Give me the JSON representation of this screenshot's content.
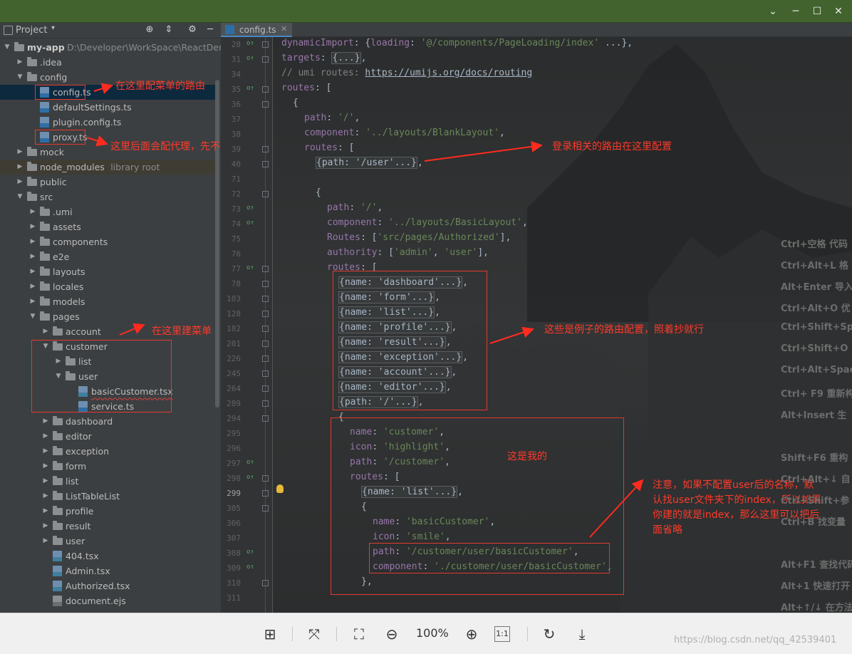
{
  "window": {
    "minimize": "─",
    "maximize": "☐",
    "close": "✕",
    "chevron": "⌄"
  },
  "project_panel": {
    "title": "Project",
    "icons": [
      "target-icon",
      "collapse-icon",
      "gear-icon",
      "hide-icon"
    ]
  },
  "tree": [
    {
      "label": "my-app",
      "hint": "D:\\Developer\\WorkSpace\\ReactDemo",
      "depth": 0,
      "kind": "folder",
      "open": true,
      "bold": true
    },
    {
      "label": ".idea",
      "depth": 1,
      "kind": "folder",
      "open": false
    },
    {
      "label": "config",
      "depth": 1,
      "kind": "folder",
      "open": true
    },
    {
      "label": "config.ts",
      "depth": 2,
      "kind": "ts",
      "selected": true,
      "boxed": true
    },
    {
      "label": "defaultSettings.ts",
      "depth": 2,
      "kind": "ts"
    },
    {
      "label": "plugin.config.ts",
      "depth": 2,
      "kind": "ts"
    },
    {
      "label": "proxy.ts",
      "depth": 2,
      "kind": "ts",
      "boxed": true
    },
    {
      "label": "mock",
      "depth": 1,
      "kind": "folder",
      "open": false
    },
    {
      "label": "node_modules",
      "hint": "library root",
      "depth": 1,
      "kind": "folder",
      "open": false,
      "ignored": true
    },
    {
      "label": "public",
      "depth": 1,
      "kind": "folder",
      "open": false
    },
    {
      "label": "src",
      "depth": 1,
      "kind": "folder",
      "open": true
    },
    {
      "label": ".umi",
      "depth": 2,
      "kind": "folder",
      "open": false
    },
    {
      "label": "assets",
      "depth": 2,
      "kind": "folder",
      "open": false
    },
    {
      "label": "components",
      "depth": 2,
      "kind": "folder",
      "open": false
    },
    {
      "label": "e2e",
      "depth": 2,
      "kind": "folder",
      "open": false
    },
    {
      "label": "layouts",
      "depth": 2,
      "kind": "folder",
      "open": false
    },
    {
      "label": "locales",
      "depth": 2,
      "kind": "folder",
      "open": false
    },
    {
      "label": "models",
      "depth": 2,
      "kind": "folder",
      "open": false
    },
    {
      "label": "pages",
      "depth": 2,
      "kind": "folder",
      "open": true
    },
    {
      "label": "account",
      "depth": 3,
      "kind": "folder",
      "open": false
    },
    {
      "label": "customer",
      "depth": 3,
      "kind": "folder",
      "open": true
    },
    {
      "label": "list",
      "depth": 4,
      "kind": "folder",
      "open": false
    },
    {
      "label": "user",
      "depth": 4,
      "kind": "folder",
      "open": true
    },
    {
      "label": "basicCustomer.tsx",
      "depth": 5,
      "kind": "tsx",
      "squig": true
    },
    {
      "label": "service.ts",
      "depth": 5,
      "kind": "ts"
    },
    {
      "label": "dashboard",
      "depth": 3,
      "kind": "folder",
      "open": false
    },
    {
      "label": "editor",
      "depth": 3,
      "kind": "folder",
      "open": false
    },
    {
      "label": "exception",
      "depth": 3,
      "kind": "folder",
      "open": false
    },
    {
      "label": "form",
      "depth": 3,
      "kind": "folder",
      "open": false
    },
    {
      "label": "list",
      "depth": 3,
      "kind": "folder",
      "open": false
    },
    {
      "label": "ListTableList",
      "depth": 3,
      "kind": "folder",
      "open": false
    },
    {
      "label": "profile",
      "depth": 3,
      "kind": "folder",
      "open": false
    },
    {
      "label": "result",
      "depth": 3,
      "kind": "folder",
      "open": false
    },
    {
      "label": "user",
      "depth": 3,
      "kind": "folder",
      "open": false
    },
    {
      "label": "404.tsx",
      "depth": 3,
      "kind": "tsx"
    },
    {
      "label": "Admin.tsx",
      "depth": 3,
      "kind": "tsx"
    },
    {
      "label": "Authorized.tsx",
      "depth": 3,
      "kind": "tsx"
    },
    {
      "label": "document.ejs",
      "depth": 3,
      "kind": "ejs"
    }
  ],
  "annotations": {
    "config": "在这里配菜单的路由",
    "proxy": "这里后面会配代理，先不管",
    "menu": "在这里建菜单",
    "login": "登录相关的路由在这里配置",
    "examples": "这些是例子的路由配置，照着抄就行",
    "mine": "这是我的",
    "note": [
      "注意，如果不配置user后的名称，默",
      "认找user文件夹下的index，所以如果",
      "你建的就是index，那么这里可以把后",
      "面省略"
    ]
  },
  "editor": {
    "tab": "config.ts",
    "current_line": "299",
    "lines": [
      {
        "n": "28",
        "mark": "o↑",
        "indent": 0,
        "html": "<span class='k'>dynamicImport</span>: {<span class='k'>loading</span>: <span class='s'>'@/components/PageLoading/index'</span> ...},"
      },
      {
        "n": "31",
        "mark": "o↑",
        "indent": 0,
        "html": "<span class='k'>targets</span>: <span class='fd'>{...}</span>,"
      },
      {
        "n": "34",
        "mark": "",
        "indent": 0,
        "html": "<span class='c'>// umi routes: </span><span class='u'>https://umijs.org/docs/routing</span>"
      },
      {
        "n": "35",
        "mark": "o↑",
        "indent": 0,
        "html": "<span class='k'>routes</span>: ["
      },
      {
        "n": "36",
        "mark": "",
        "indent": 1,
        "html": "{"
      },
      {
        "n": "37",
        "mark": "",
        "indent": 2,
        "html": "<span class='k'>path</span>: <span class='s'>'/'</span>,"
      },
      {
        "n": "38",
        "mark": "",
        "indent": 2,
        "html": "<span class='k'>component</span>: <span class='s'>'../layouts/BlankLayout'</span>,"
      },
      {
        "n": "39",
        "mark": "",
        "indent": 2,
        "html": "<span class='k'>routes</span>: ["
      },
      {
        "n": "40",
        "mark": "",
        "indent": 3,
        "html": "<span class='fd'>{path: '/user'...}</span>,"
      },
      {
        "n": "71",
        "mark": "",
        "indent": 0,
        "html": ""
      },
      {
        "n": "72",
        "mark": "",
        "indent": 3,
        "html": "{"
      },
      {
        "n": "73",
        "mark": "o↑",
        "indent": 4,
        "html": "<span class='k'>path</span>: <span class='s'>'/'</span>,"
      },
      {
        "n": "74",
        "mark": "o↑",
        "indent": 4,
        "html": "<span class='k'>component</span>: <span class='s'>'../layouts/BasicLayout'</span>,"
      },
      {
        "n": "75",
        "mark": "",
        "indent": 4,
        "html": "<span class='k'>Routes</span>: [<span class='s'>'src/pages/Authorized'</span>],"
      },
      {
        "n": "76",
        "mark": "",
        "indent": 4,
        "html": "<span class='k'>authority</span>: [<span class='s'>'admin'</span>, <span class='s'>'user'</span>],"
      },
      {
        "n": "77",
        "mark": "o↑",
        "indent": 4,
        "html": "<span class='k'>routes</span>: ["
      },
      {
        "n": "78",
        "mark": "",
        "indent": 5,
        "html": "<span class='fd'>{name: 'dashboard'...}</span>,"
      },
      {
        "n": "103",
        "mark": "",
        "indent": 5,
        "html": "<span class='fd'>{name: 'form'...}</span>,"
      },
      {
        "n": "128",
        "mark": "",
        "indent": 5,
        "html": "<span class='fd'>{name: 'list'...}</span>,"
      },
      {
        "n": "182",
        "mark": "",
        "indent": 5,
        "html": "<span class='fd'>{name: 'profile'...}</span>,"
      },
      {
        "n": "201",
        "mark": "",
        "indent": 5,
        "html": "<span class='fd'>{name: 'result'...}</span>,"
      },
      {
        "n": "226",
        "mark": "",
        "indent": 5,
        "html": "<span class='fd'>{name: 'exception'...}</span>,"
      },
      {
        "n": "245",
        "mark": "",
        "indent": 5,
        "html": "<span class='fd'>{name: 'account'...}</span>,"
      },
      {
        "n": "264",
        "mark": "",
        "indent": 5,
        "html": "<span class='fd'>{name: 'editor'...}</span>,"
      },
      {
        "n": "289",
        "mark": "",
        "indent": 5,
        "html": "<span class='fd'>{path: '/'...}</span>,"
      },
      {
        "n": "294",
        "mark": "",
        "indent": 5,
        "html": "{"
      },
      {
        "n": "295",
        "mark": "",
        "indent": 6,
        "html": "<span class='k'>name</span>: <span class='s'>'customer'</span>,"
      },
      {
        "n": "296",
        "mark": "",
        "indent": 6,
        "html": "<span class='k'>icon</span>: <span class='s'>'highlight'</span>,"
      },
      {
        "n": "297",
        "mark": "o↑",
        "indent": 6,
        "html": "<span class='k'>path</span>: <span class='s'>'/customer'</span>,"
      },
      {
        "n": "298",
        "mark": "o↑",
        "indent": 6,
        "html": "<span class='k'>routes</span>: ["
      },
      {
        "n": "299",
        "mark": "",
        "indent": 7,
        "html": "<span class='fd'>{name: 'list'...}</span>,"
      },
      {
        "n": "305",
        "mark": "",
        "indent": 7,
        "html": "{"
      },
      {
        "n": "306",
        "mark": "",
        "indent": 8,
        "html": "<span class='k'>name</span>: <span class='s'>'basicCustomer'</span>,"
      },
      {
        "n": "307",
        "mark": "",
        "indent": 8,
        "html": "<span class='k'>icon</span>: <span class='s'>'smile'</span>,"
      },
      {
        "n": "308",
        "mark": "o↑",
        "indent": 8,
        "html": "<span class='k'>path</span>: <span class='s'>'/customer/user/basicCustomer'</span>,"
      },
      {
        "n": "309",
        "mark": "o↑",
        "indent": 8,
        "html": "<span class='k'>component</span>: <span class='s'>'./customer/user/basicCustomer'</span>,"
      },
      {
        "n": "310",
        "mark": "",
        "indent": 7,
        "html": "},"
      },
      {
        "n": "311",
        "mark": "",
        "indent": 0,
        "html": ""
      }
    ]
  },
  "shortcut_hints": [
    "Ctrl+空格  代码",
    "Ctrl+Alt+L  格",
    "Alt+Enter  导入",
    "Ctrl+Alt+O  优",
    "Ctrl+Shift+Sp",
    "Ctrl+Shift+O",
    "Ctrl+Alt+Spac",
    "Ctrl+ F9  重新构",
    "Alt+Insert  生",
    "Shift+F6  重构",
    "Ctrl+Alt+↓  自",
    "Ctrl+Shift+参",
    "Ctrl+B  找变量",
    "Alt+F1  查找代码",
    "Alt+1  快速打开",
    "Alt+↑/↓  在方法"
  ],
  "viewer_toolbar": {
    "zoom": "100%",
    "buttons": [
      "layout-icon",
      "fit-icon",
      "crop-icon",
      "zoom-out-icon",
      "zoom-in-icon",
      "actual-size-icon",
      "rotate-icon",
      "download-icon"
    ],
    "actual_size": "1:1"
  },
  "watermark": "https://blog.csdn.net/qq_42539401"
}
